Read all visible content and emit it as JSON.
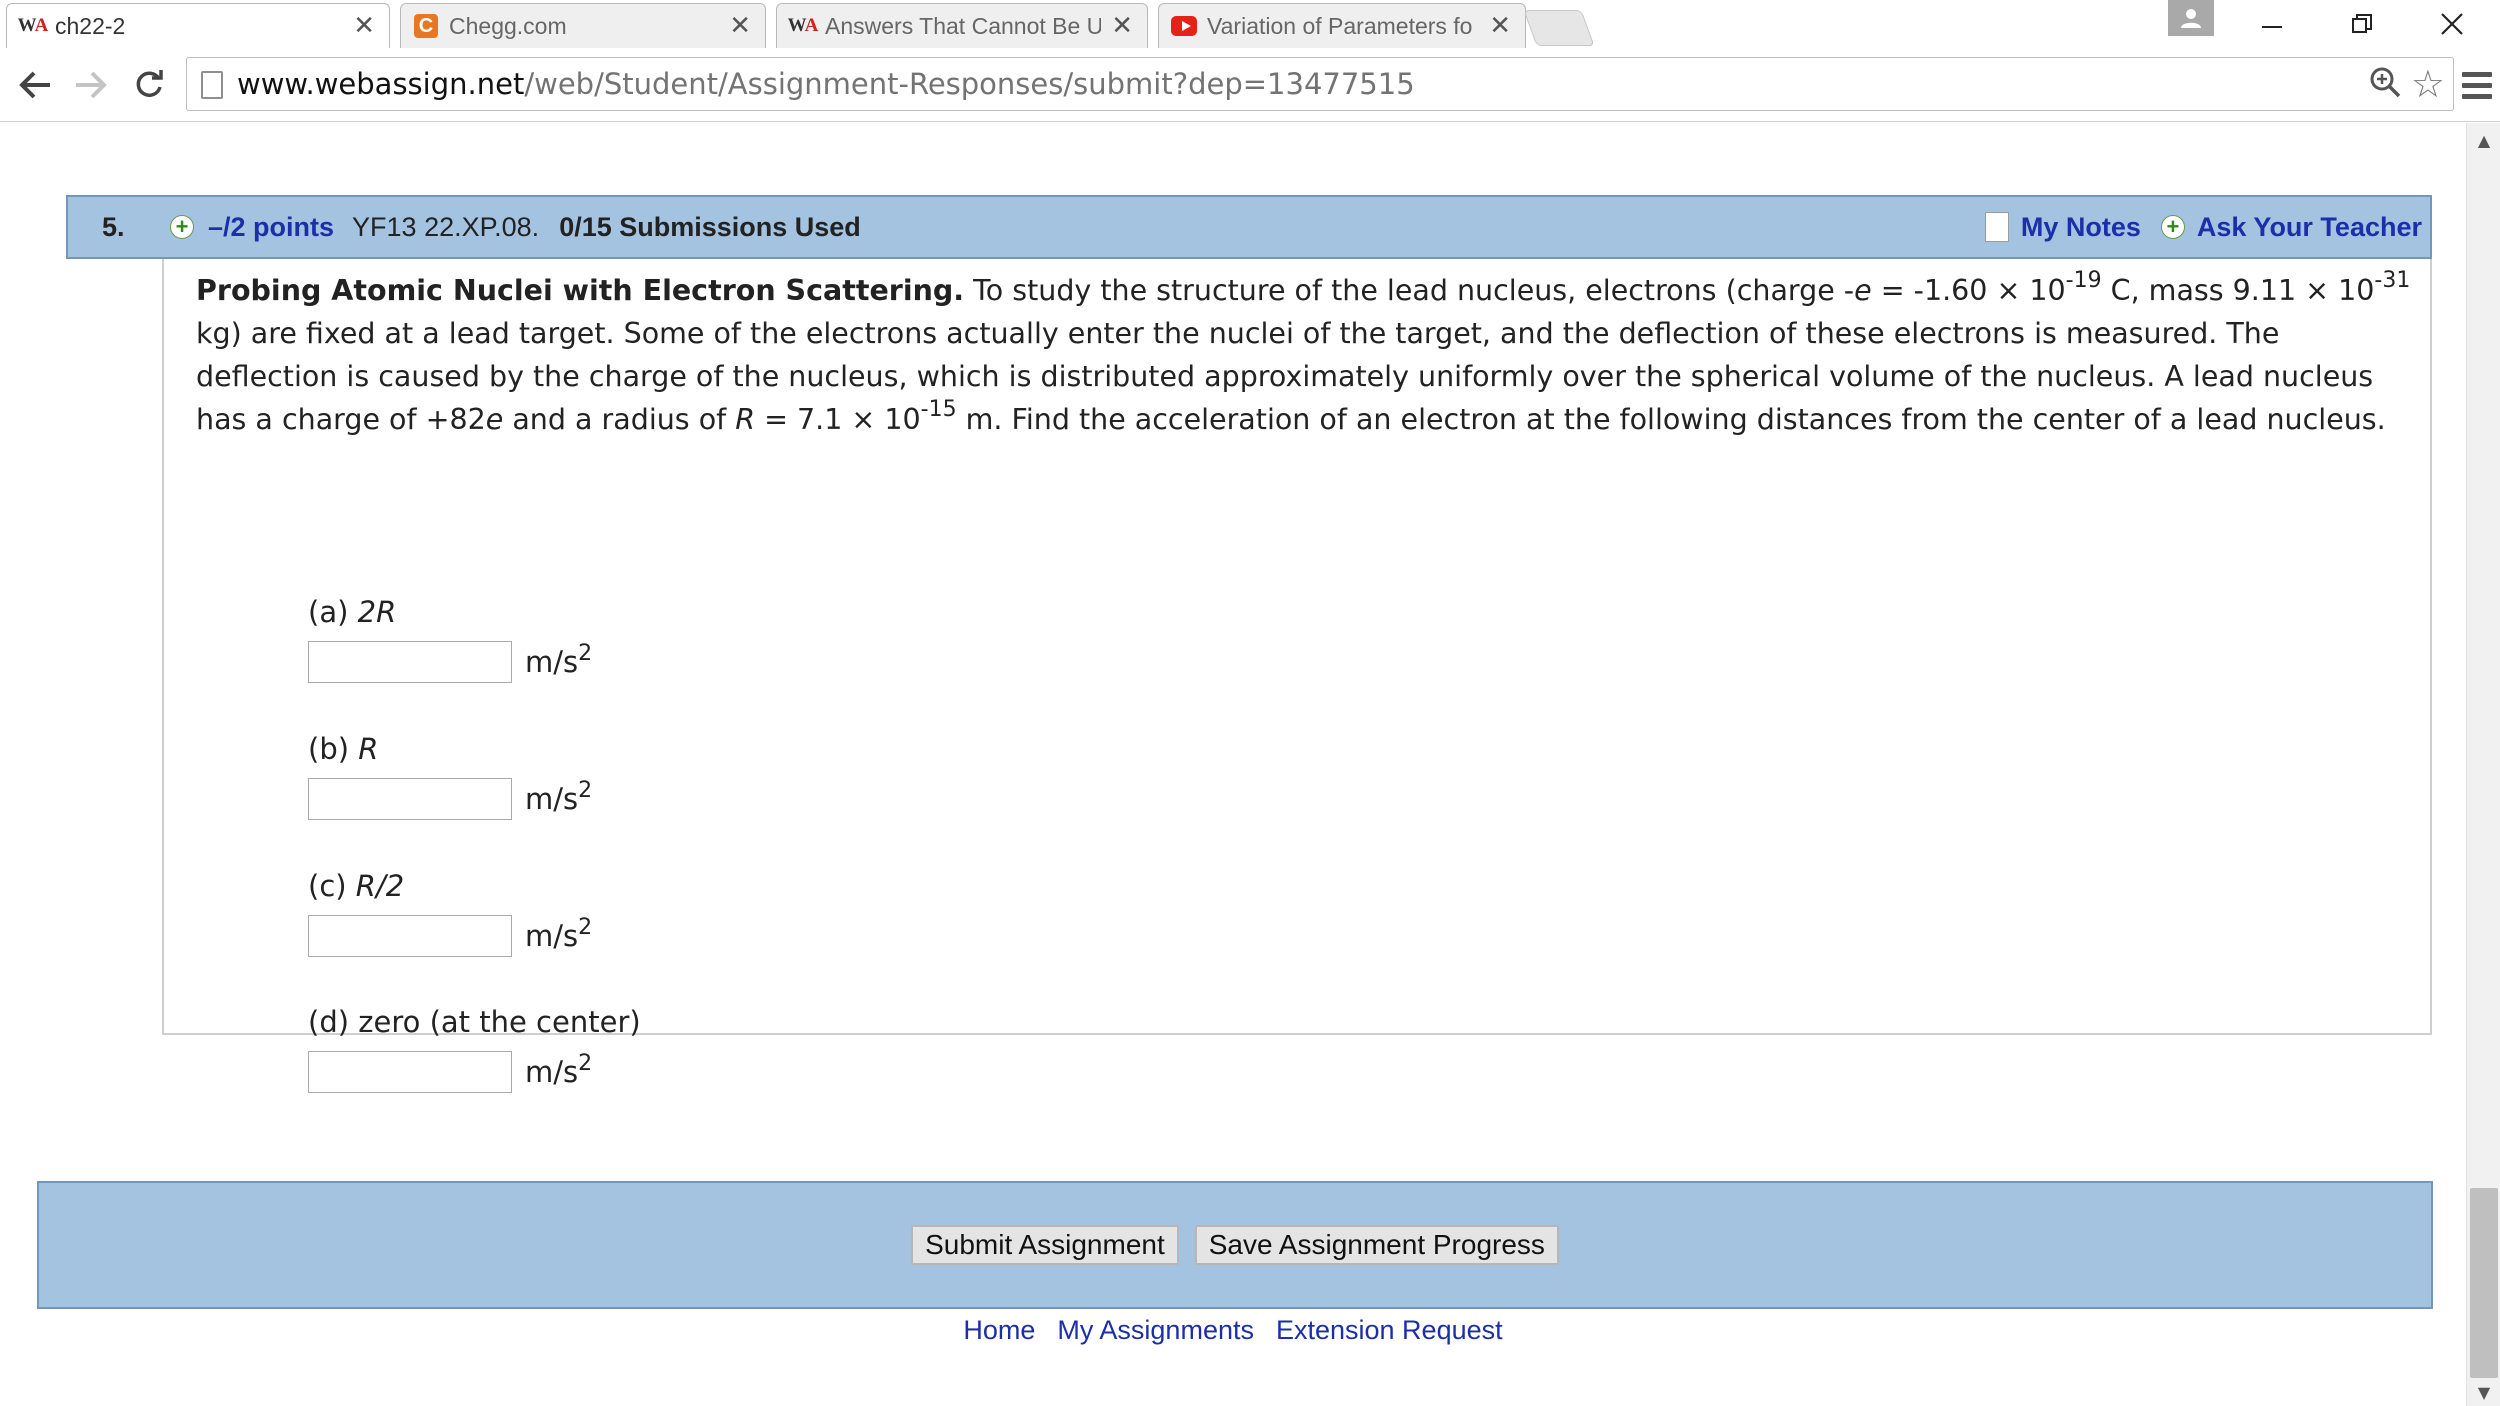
{
  "browser": {
    "tabs": [
      {
        "title": "ch22-2",
        "icon": "webassign-icon",
        "active": true
      },
      {
        "title": "Chegg.com",
        "icon": "chegg-icon",
        "active": false
      },
      {
        "title": "Answers That Cannot Be U",
        "icon": "webassign-icon",
        "active": false
      },
      {
        "title": "Variation of Parameters fo",
        "icon": "youtube-icon",
        "active": false
      }
    ],
    "url_host": "www.webassign.net",
    "url_path": "/web/Student/Assignment-Responses/submit?dep=13477515"
  },
  "question": {
    "number": "5.",
    "points": "–/2 points",
    "code": "YF13 22.XP.08.",
    "submissions": "0/15 Submissions Used",
    "my_notes": "My Notes",
    "ask_teacher": "Ask Your Teacher",
    "title": "Probing Atomic Nuclei with Electron Scattering.",
    "text": {
      "s1": " To study the structure of the lead nucleus, electrons (charge -",
      "e": "e",
      "s2": " = -1.60 × 10",
      "exp1": "-19",
      "s3": " C, mass 9.11 × 10",
      "exp2": "-31",
      "s4": " kg) are fixed at a lead target. Some of the electrons actually enter the nuclei of the target, and the deflection of these electrons is measured. The deflection is caused by the charge of the nucleus, which is distributed approximately uniformly over the spherical volume of the nucleus. A lead nucleus has a charge of +82",
      "e2": "e",
      "s5": " and a radius of ",
      "R": "R",
      "s6": " = 7.1 × 10",
      "exp3": "-15",
      "s7": " m. Find the acceleration of an electron at the following distances from the center of a lead nucleus."
    },
    "parts": [
      {
        "label": "(a) ",
        "var": "2R",
        "value": "",
        "unit": "m/s",
        "unit_exp": "2"
      },
      {
        "label": "(b) ",
        "var": "R",
        "value": "",
        "unit": "m/s",
        "unit_exp": "2"
      },
      {
        "label": "(c) ",
        "var": "R/2",
        "value": "",
        "unit": "m/s",
        "unit_exp": "2"
      },
      {
        "label": "(d) ",
        "var": "zero (at the center)",
        "value": "",
        "unit": "m/s",
        "unit_exp": "2"
      }
    ]
  },
  "actions": {
    "submit": "Submit Assignment",
    "save": "Save Assignment Progress"
  },
  "footer": {
    "home": "Home",
    "my_assignments": "My Assignments",
    "extension": "Extension Request"
  }
}
